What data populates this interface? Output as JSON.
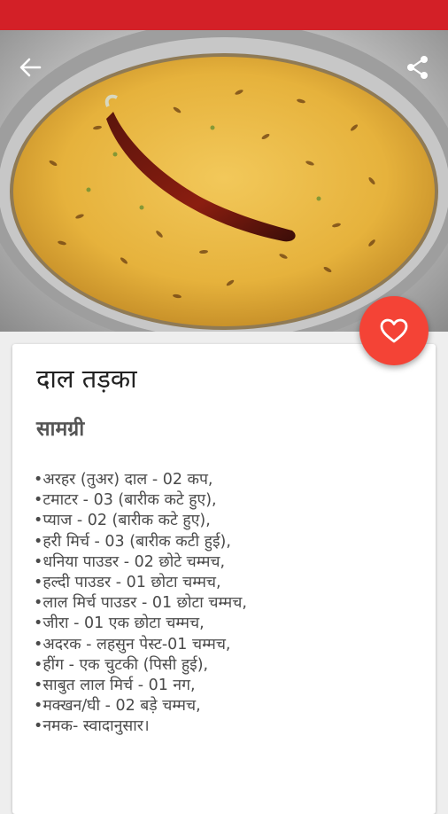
{
  "recipe": {
    "title": "दाल तड़का",
    "ingredients_heading": "सामग्री",
    "ingredients": [
      "अरहर (तुअर) दाल - 02 कप,",
      "टमाटर - 03 (बारीक कटे हुए),",
      "प्याज - 02 (बारीक कटे हुए),",
      "हरी मिर्च  - 03 (बारीक कटी हुई),",
      "धनिया पाउडर - 02 छोटे चम्मच,",
      "हल्दी पाउडर - 01 छोटा चम्मच,",
      "लाल मिर्च पाउडर - 01 छोटा चम्मच,",
      "जीरा - 01 एक छोटा चम्मच,",
      "अदरक - लहसुन पेस्ट-01 चम्मच,",
      "हींग - एक चुटकी (पिसी हुई),",
      "साबुत लाल मिर्च - 01 नग,",
      "मक्खन/घी - 02 बड़े चम्मच,",
      "नमक- स्वादानुसार।"
    ]
  },
  "icons": {
    "back": "arrow-left-icon",
    "share": "share-icon",
    "favorite": "heart-outline-icon"
  },
  "colors": {
    "status_bar": "#d32027",
    "fab": "#f44336",
    "card": "#ffffff",
    "background": "#eeeeee"
  }
}
